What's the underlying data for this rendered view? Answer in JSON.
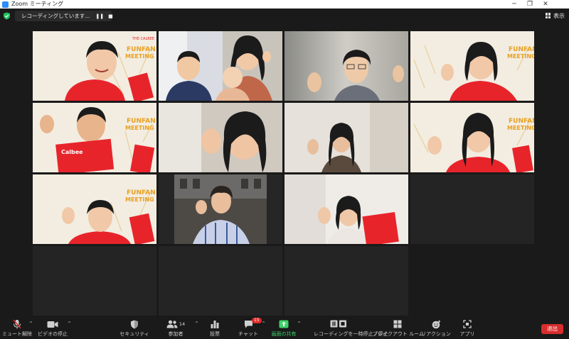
{
  "window": {
    "title": "Zoom ミーティング",
    "controls": [
      "─",
      "❐",
      "✕"
    ]
  },
  "recording": {
    "status_text": "レコーディングしています...",
    "pause_label": "❚❚",
    "stop_label": "■"
  },
  "view_button": {
    "label": "表示"
  },
  "participants_tiles": [
    {
      "row": 0,
      "col": 0,
      "kind": "branded",
      "people": 1
    },
    {
      "row": 0,
      "col": 1,
      "kind": "home",
      "people": 3
    },
    {
      "row": 0,
      "col": 2,
      "kind": "home",
      "people": 1
    },
    {
      "row": 0,
      "col": 3,
      "kind": "branded",
      "people": 1
    },
    {
      "row": 1,
      "col": 0,
      "kind": "branded",
      "people": 1
    },
    {
      "row": 1,
      "col": 1,
      "kind": "home",
      "people": 1
    },
    {
      "row": 1,
      "col": 2,
      "kind": "home",
      "people": 1
    },
    {
      "row": 1,
      "col": 3,
      "kind": "branded",
      "people": 1
    },
    {
      "row": 2,
      "col": 0,
      "kind": "branded",
      "people": 1
    },
    {
      "row": 2,
      "col": 1,
      "kind": "street",
      "people": 1
    },
    {
      "row": 2,
      "col": 2,
      "kind": "home",
      "people": 1
    }
  ],
  "branding": {
    "line1": "FUNFAN",
    "line2": "MEETING",
    "snack": "Calbee"
  },
  "colors": {
    "accent_red": "#e8242b",
    "share_green": "#3fd16a",
    "leave_red": "#d92d2d"
  },
  "toolbar": {
    "mute": {
      "label": "ミュート解除",
      "icon": "mic-off-icon"
    },
    "video": {
      "label": "ビデオの停止",
      "icon": "video-camera-icon"
    },
    "security": {
      "label": "セキュリティ",
      "icon": "shield-icon"
    },
    "participants": {
      "label": "参加者",
      "icon": "participants-icon",
      "count": "14"
    },
    "polls": {
      "label": "投票",
      "icon": "bar-chart-icon"
    },
    "chat": {
      "label": "チャット",
      "icon": "chat-bubble-icon",
      "badge": "15"
    },
    "share": {
      "label": "画面の共有",
      "icon": "share-screen-icon"
    },
    "pause_rec": {
      "label": "レコーディングを一時停止／停止",
      "icon": "pause-stop-icon"
    },
    "breakout": {
      "label": "ブレイクアウト ルーム",
      "icon": "breakout-icon"
    },
    "reactions": {
      "label": "リアクション",
      "icon": "smiley-plus-icon"
    },
    "apps": {
      "label": "アプリ",
      "icon": "apps-icon"
    },
    "leave": {
      "label": "退出"
    }
  }
}
